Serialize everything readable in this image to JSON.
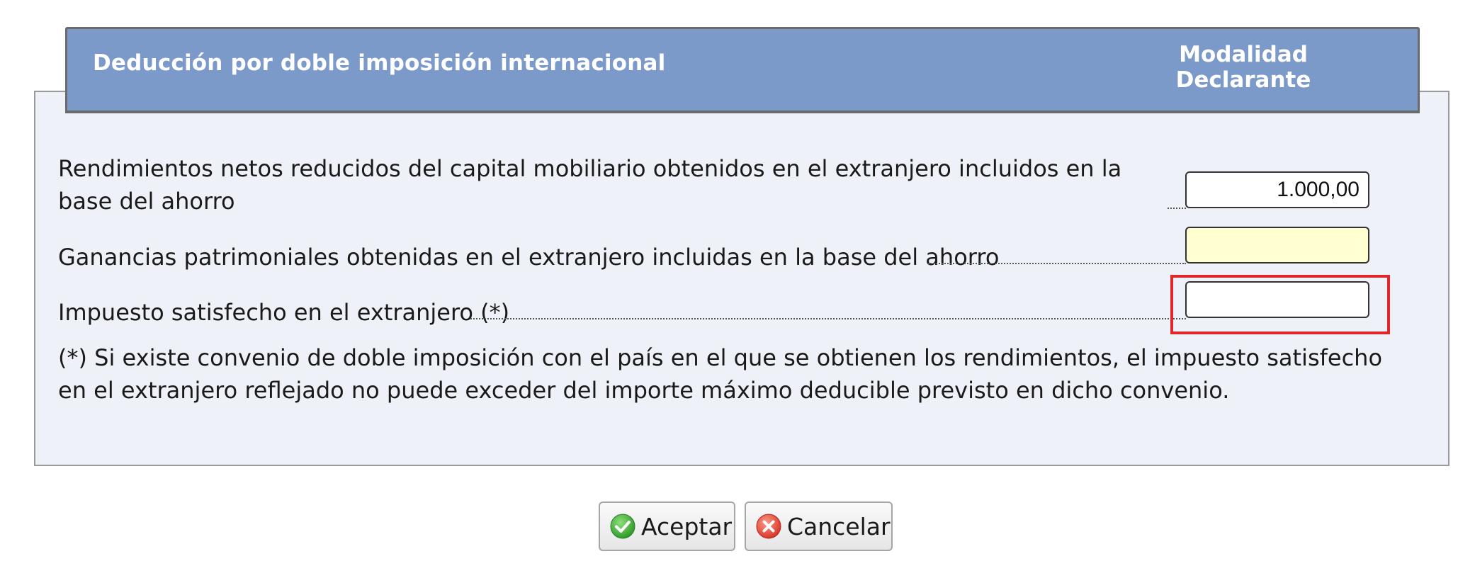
{
  "header": {
    "title": "Deducción por doble imposición internacional",
    "column_line1": "Modalidad",
    "column_line2": "Declarante"
  },
  "rows": [
    {
      "label": "Rendimientos netos reducidos del capital mobiliario obtenidos en el extranjero incluidos en la base del ahorro",
      "value": "1.000,00",
      "field_bg": "#ffffff"
    },
    {
      "label": "Ganancias patrimoniales obtenidas en el extranjero incluidas en la base del ahorro",
      "value": "",
      "field_bg": "#ffffd2"
    },
    {
      "label": "Impuesto satisfecho en el extranjero (*)",
      "value": "",
      "field_bg": "#ffffff",
      "highlighted": true
    }
  ],
  "note": "(*) Si existe convenio de doble imposición con el país en el que se obtienen los rendimientos, el impuesto satisfecho en el extranjero reflejado no puede exceder del importe máximo deducible previsto en dicho convenio.",
  "buttons": {
    "accept_label": "Aceptar",
    "accept_icon": "check-circle-icon",
    "cancel_label": "Cancelar",
    "cancel_icon": "cancel-circle-icon"
  },
  "colors": {
    "header_bg": "#7b99c9",
    "panel_bg": "#eef1f8",
    "highlight": "#e0262b",
    "accept_green": "#3aa832",
    "cancel_red": "#e24a3a"
  }
}
